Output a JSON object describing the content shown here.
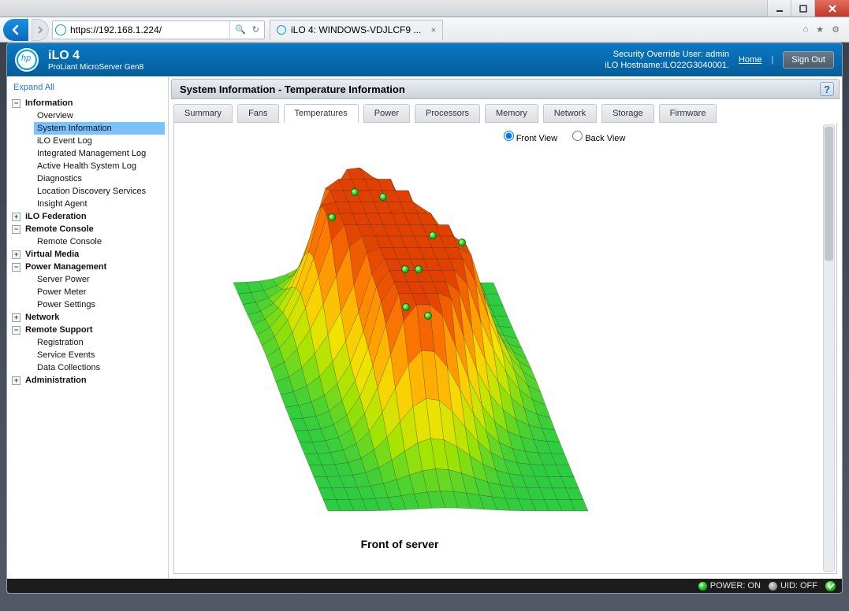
{
  "browser": {
    "url": "https://192.168.1.224/",
    "tab_title": "iLO 4: WINDOWS-VDJLCF9 ..."
  },
  "header": {
    "product": "iLO 4",
    "subtitle": "ProLiant MicroServer Gen8",
    "security_line1": "Security Override User:  admin",
    "security_line2": "iLO Hostname:ILO22G3040001.",
    "home_label": "Home",
    "signout_label": "Sign Out"
  },
  "sidebar": {
    "expand_all": "Expand All",
    "sections": [
      {
        "label": "Information",
        "open": true,
        "children": [
          "Overview",
          "System Information",
          "iLO Event Log",
          "Integrated Management Log",
          "Active Health System Log",
          "Diagnostics",
          "Location Discovery Services",
          "Insight Agent"
        ],
        "active_child": "System Information"
      },
      {
        "label": "iLO Federation",
        "open": false
      },
      {
        "label": "Remote Console",
        "open": true,
        "children": [
          "Remote Console"
        ]
      },
      {
        "label": "Virtual Media",
        "open": false
      },
      {
        "label": "Power Management",
        "open": true,
        "children": [
          "Server Power",
          "Power Meter",
          "Power Settings"
        ]
      },
      {
        "label": "Network",
        "open": false
      },
      {
        "label": "Remote Support",
        "open": true,
        "children": [
          "Registration",
          "Service Events",
          "Data Collections"
        ]
      },
      {
        "label": "Administration",
        "open": false
      }
    ]
  },
  "main": {
    "title": "System Information - Temperature Information",
    "help": "?",
    "tabs": [
      "Summary",
      "Fans",
      "Temperatures",
      "Power",
      "Processors",
      "Memory",
      "Network",
      "Storage",
      "Firmware"
    ],
    "active_tab": "Temperatures",
    "view": {
      "front": "Front View",
      "back": "Back View",
      "selected": "front"
    },
    "chart_caption": "Front of server"
  },
  "status": {
    "power": "POWER: ON",
    "uid": "UID: OFF"
  },
  "chart_data": {
    "type": "heatmap",
    "description": "3D isometric thermal surface map of server front view. Relative peak heights estimated 0-1.",
    "sensors": [
      {
        "x": 0.4,
        "y": 0.22,
        "value": 1.0
      },
      {
        "x": 0.5,
        "y": 0.24,
        "value": 0.98
      },
      {
        "x": 0.27,
        "y": 0.33,
        "value": 0.55
      },
      {
        "x": 0.73,
        "y": 0.44,
        "value": 0.45
      },
      {
        "x": 0.63,
        "y": 0.41,
        "value": 0.7
      },
      {
        "x": 0.47,
        "y": 0.56,
        "value": 0.65
      },
      {
        "x": 0.52,
        "y": 0.56,
        "value": 0.62
      },
      {
        "x": 0.42,
        "y": 0.7,
        "value": 0.3
      },
      {
        "x": 0.5,
        "y": 0.72,
        "value": 0.18
      }
    ],
    "colormap": [
      "#2ecc40",
      "#a4e400",
      "#f4e300",
      "#ffb000",
      "#ff7a00",
      "#e04000"
    ]
  }
}
